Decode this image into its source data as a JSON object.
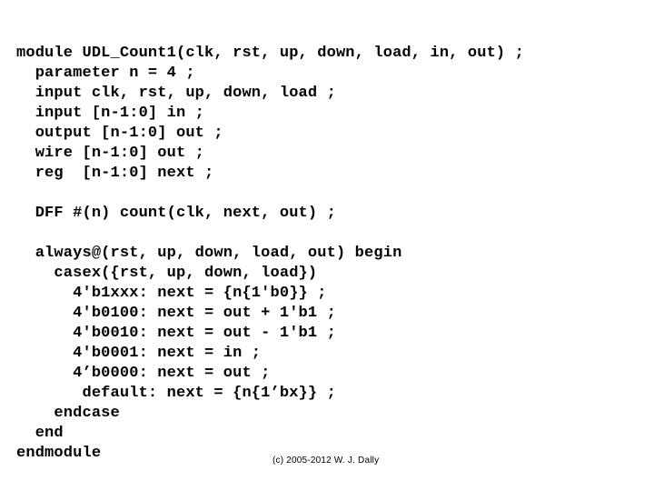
{
  "slide": {
    "background_color": "#ffffff",
    "text_color": "#000000",
    "code_lines": [
      "module UDL_Count1(clk, rst, up, down, load, in, out) ;",
      "  parameter n = 4 ;",
      "  input clk, rst, up, down, load ;",
      "  input [n-1:0] in ;",
      "  output [n-1:0] out ;",
      "  wire [n-1:0] out ;",
      "  reg  [n-1:0] next ;",
      "",
      "  DFF #(n) count(clk, next, out) ;",
      "",
      "  always@(rst, up, down, load, out) begin",
      "    casex({rst, up, down, load})",
      "      4'b1xxx: next = {n{1'b0}} ;",
      "      4'b0100: next = out + 1'b1 ;",
      "      4'b0010: next = out - 1'b1 ;",
      "      4'b0001: next = in ;",
      "      4’b0000: next = out ;",
      "       default: next = {n{1’bx}} ;",
      "    endcase",
      "  end",
      "endmodule"
    ],
    "footer_credit": "(c) 2005-2012 W. J. Dally"
  }
}
